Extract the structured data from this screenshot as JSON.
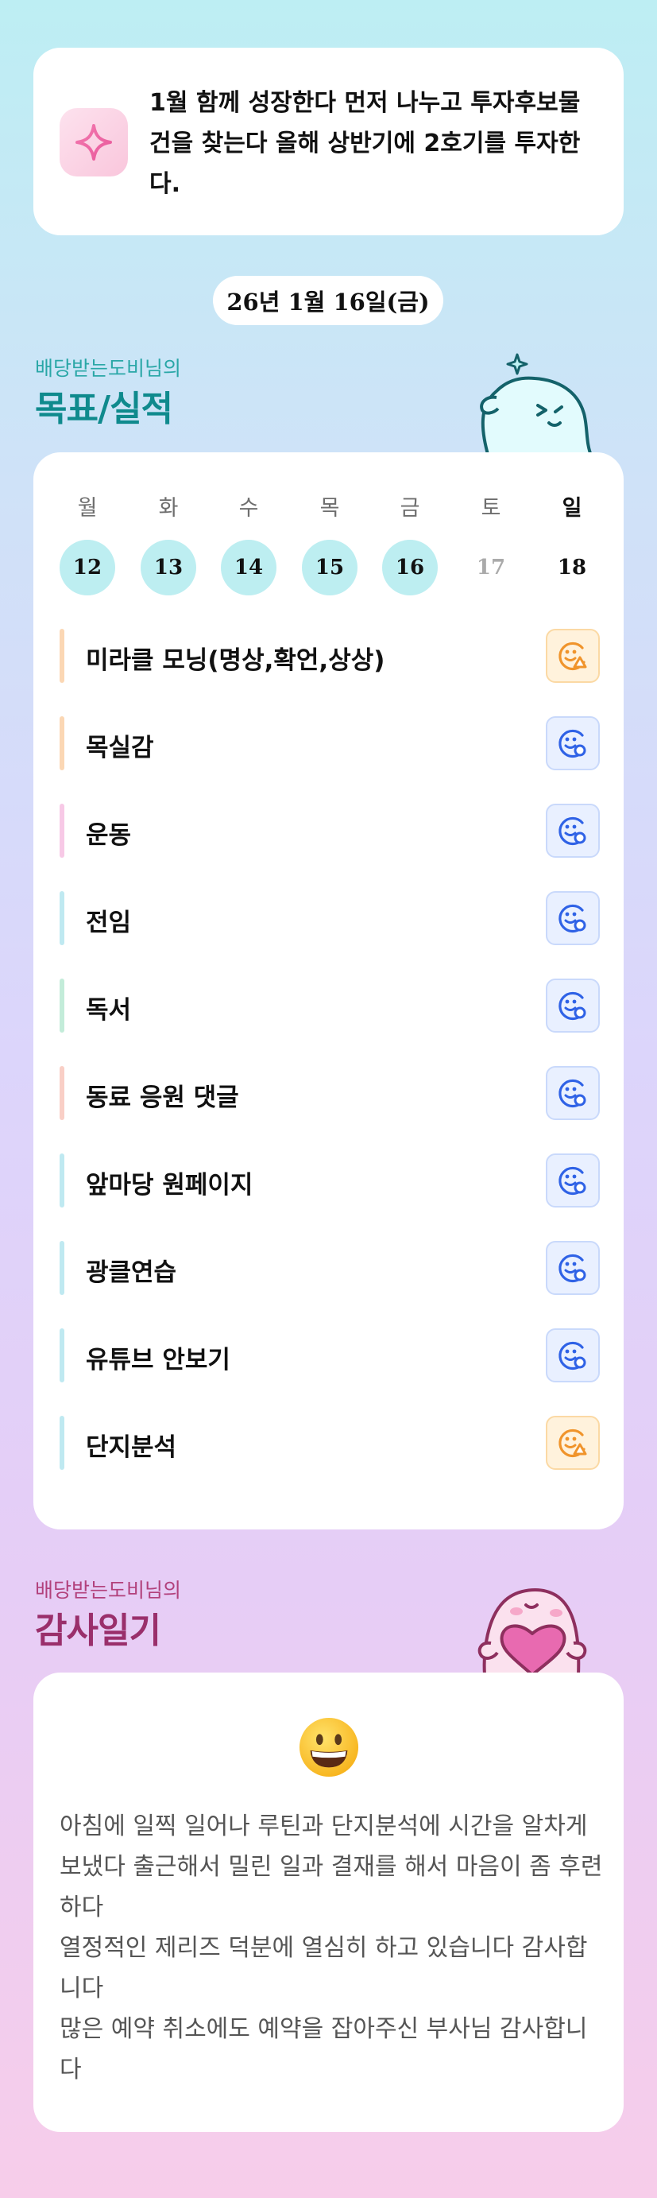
{
  "goal": {
    "icon": "sparkle-icon",
    "text": "1월 함께 성장한다 먼저 나누고 투자후보물건을 찾는다 올해 상반기에 2호기를 투자한다."
  },
  "date_label": "26년 1월 16일(금)",
  "routine_section": {
    "subtitle": "배당받는도비님의",
    "title": "목표/실적"
  },
  "weekdays": [
    "월",
    "화",
    "수",
    "목",
    "금",
    "토",
    "일"
  ],
  "days": [
    {
      "num": "12",
      "state": "done"
    },
    {
      "num": "13",
      "state": "done"
    },
    {
      "num": "14",
      "state": "done"
    },
    {
      "num": "15",
      "state": "done"
    },
    {
      "num": "16",
      "state": "done"
    },
    {
      "num": "17",
      "state": "future"
    },
    {
      "num": "18",
      "state": "today"
    }
  ],
  "routines": [
    {
      "label": "미라클 모닝(명상,확언,상상)",
      "bar_color": "#fbd7b4",
      "status": "warn",
      "status_icon": "face-warning-icon"
    },
    {
      "label": "목실감",
      "bar_color": "#fbd7b4",
      "status": "good",
      "status_icon": "face-check-icon"
    },
    {
      "label": "운동",
      "bar_color": "#f7c9e6",
      "status": "good",
      "status_icon": "face-check-icon"
    },
    {
      "label": "전임",
      "bar_color": "#bfe9f1",
      "status": "good",
      "status_icon": "face-check-icon"
    },
    {
      "label": "독서",
      "bar_color": "#c3ecd9",
      "status": "good",
      "status_icon": "face-check-icon"
    },
    {
      "label": "동료 응원 댓글",
      "bar_color": "#f9cfc6",
      "status": "good",
      "status_icon": "face-check-icon"
    },
    {
      "label": "앞마당 원페이지",
      "bar_color": "#bfe9f1",
      "status": "good",
      "status_icon": "face-check-icon"
    },
    {
      "label": "광클연습",
      "bar_color": "#bfe9f1",
      "status": "good",
      "status_icon": "face-check-icon"
    },
    {
      "label": "유튜브 안보기",
      "bar_color": "#bfe9f1",
      "status": "good",
      "status_icon": "face-check-icon"
    },
    {
      "label": "단지분석",
      "bar_color": "#bfe9f1",
      "status": "warn",
      "status_icon": "face-warning-icon"
    }
  ],
  "gratitude_section": {
    "subtitle": "배당받는도비님의",
    "title": "감사일기"
  },
  "gratitude": {
    "emoji": "grinning-face-icon",
    "lines": [
      "아침에 일찍 일어나 루틴과 단지분석에 시간을 알차게 보냈다 출근해서 밀린 일과 결재를 해서 마음이 좀 후련하다",
      "열정적인 제리즈 덕분에 열심히 하고 있습니다 감사합니다",
      "많은 예약 취소에도 예약을 잡아주신 부사님 감사합니다"
    ]
  },
  "colors": {
    "done_day": "#bdeef1",
    "good_icon": "#2f62e6",
    "warn_icon": "#f0942b",
    "routine_title": "#0f8a8d",
    "gratitude_title": "#9a2f6b"
  }
}
